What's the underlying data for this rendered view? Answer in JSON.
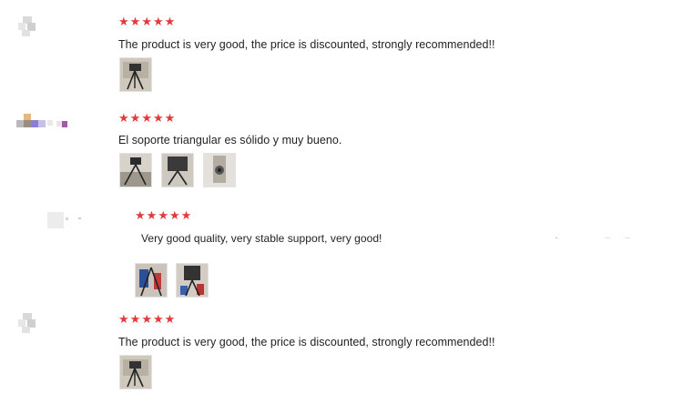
{
  "colors": {
    "star": "#e4393c",
    "text": "#222222",
    "thumb_border": "#e3e3e3"
  },
  "reviews": [
    {
      "rating": 5,
      "stars": [
        "★",
        "★",
        "★",
        "★",
        "★"
      ],
      "text": "The product is very good, the price is discounted, strongly recommended!!",
      "photos": [
        "tripod-photo"
      ]
    },
    {
      "rating": 5,
      "stars": [
        "★",
        "★",
        "★",
        "★",
        "★"
      ],
      "text": "El soporte triangular es sólido y muy bueno.",
      "photos": [
        "tripod-photo",
        "tripod-photo",
        "tripod-photo"
      ]
    },
    {
      "rating": 5,
      "stars": [
        "★",
        "★",
        "★",
        "★",
        "★"
      ],
      "text": "Very good quality, very stable support, very good!",
      "photos": [
        "tripod-photo",
        "tripod-photo"
      ]
    },
    {
      "rating": 5,
      "stars": [
        "★",
        "★",
        "★",
        "★",
        "★"
      ],
      "text": "The product is very good, the price is discounted, strongly recommended!!",
      "photos": [
        "tripod-photo"
      ]
    }
  ]
}
